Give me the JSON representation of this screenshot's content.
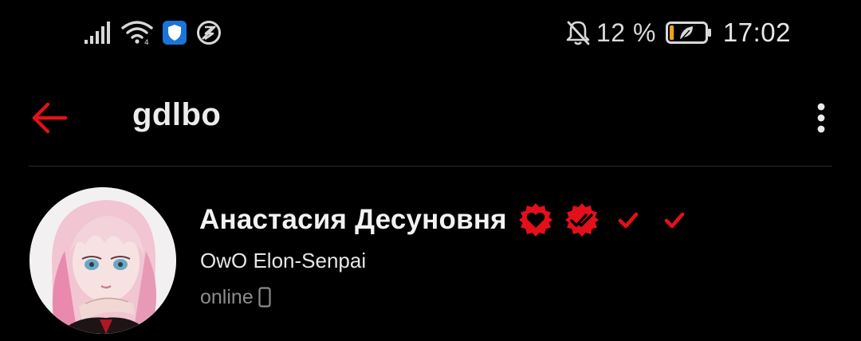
{
  "status_bar": {
    "icons_left": [
      "signal-icon",
      "wifi-icon",
      "vpn-shield-icon",
      "data-saver-icon"
    ],
    "icons_right": [
      "notifications-off-icon",
      "battery-saver-icon"
    ],
    "battery_percent": "12 %",
    "time": "17:02",
    "battery_fill_level": 0.12
  },
  "app_bar": {
    "title": "gdlbo",
    "back_icon": "arrow-left-icon",
    "menu_icon": "more-vertical-icon"
  },
  "profile": {
    "name": "Анастасия Десуновня",
    "status": "OwO Elon-Senpai",
    "presence": "online",
    "presence_device_icon": "phone-icon",
    "badges": [
      "heart-badge-icon",
      "verified-double-check-badge-icon",
      "check-icon",
      "check-icon"
    ]
  },
  "colors": {
    "background": "#000000",
    "accent": "#e3101a",
    "battery_fill": "#f0a020",
    "vpn_icon": "#1a74d9"
  }
}
